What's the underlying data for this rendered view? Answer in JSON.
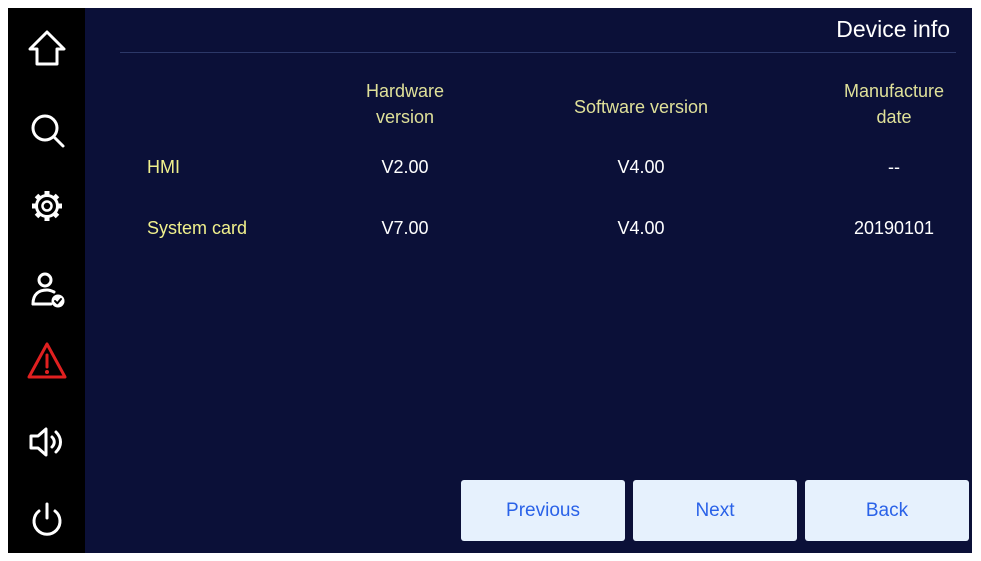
{
  "header": {
    "title": "Device info"
  },
  "sidebar": {
    "items": [
      {
        "icon": "home-icon"
      },
      {
        "icon": "search-icon"
      },
      {
        "icon": "gear-icon"
      },
      {
        "icon": "user-check-icon"
      },
      {
        "icon": "warning-icon",
        "color": "#e02020"
      },
      {
        "icon": "speaker-icon"
      },
      {
        "icon": "power-icon"
      }
    ]
  },
  "table": {
    "columns": [
      "",
      "Hardware\nversion",
      "Software version",
      "Manufacture\ndate"
    ],
    "col_hardware_l1": "Hardware",
    "col_hardware_l2": "version",
    "col_software": "Software version",
    "col_date_l1": "Manufacture",
    "col_date_l2": "date",
    "rows": [
      {
        "name": "HMI",
        "hardware": "V2.00",
        "software": "V4.00",
        "date": "--"
      },
      {
        "name": "System card",
        "hardware": "V7.00",
        "software": "V4.00",
        "date": "20190101"
      }
    ]
  },
  "buttons": {
    "previous": "Previous",
    "next": "Next",
    "back": "Back"
  },
  "colors": {
    "background": "#0b1038",
    "sidebar": "#000000",
    "row_label": "#f0f08c",
    "header_text": "#dfe099",
    "button_bg": "#e6f1fd",
    "button_text": "#2a62e8",
    "warning": "#e02020"
  }
}
